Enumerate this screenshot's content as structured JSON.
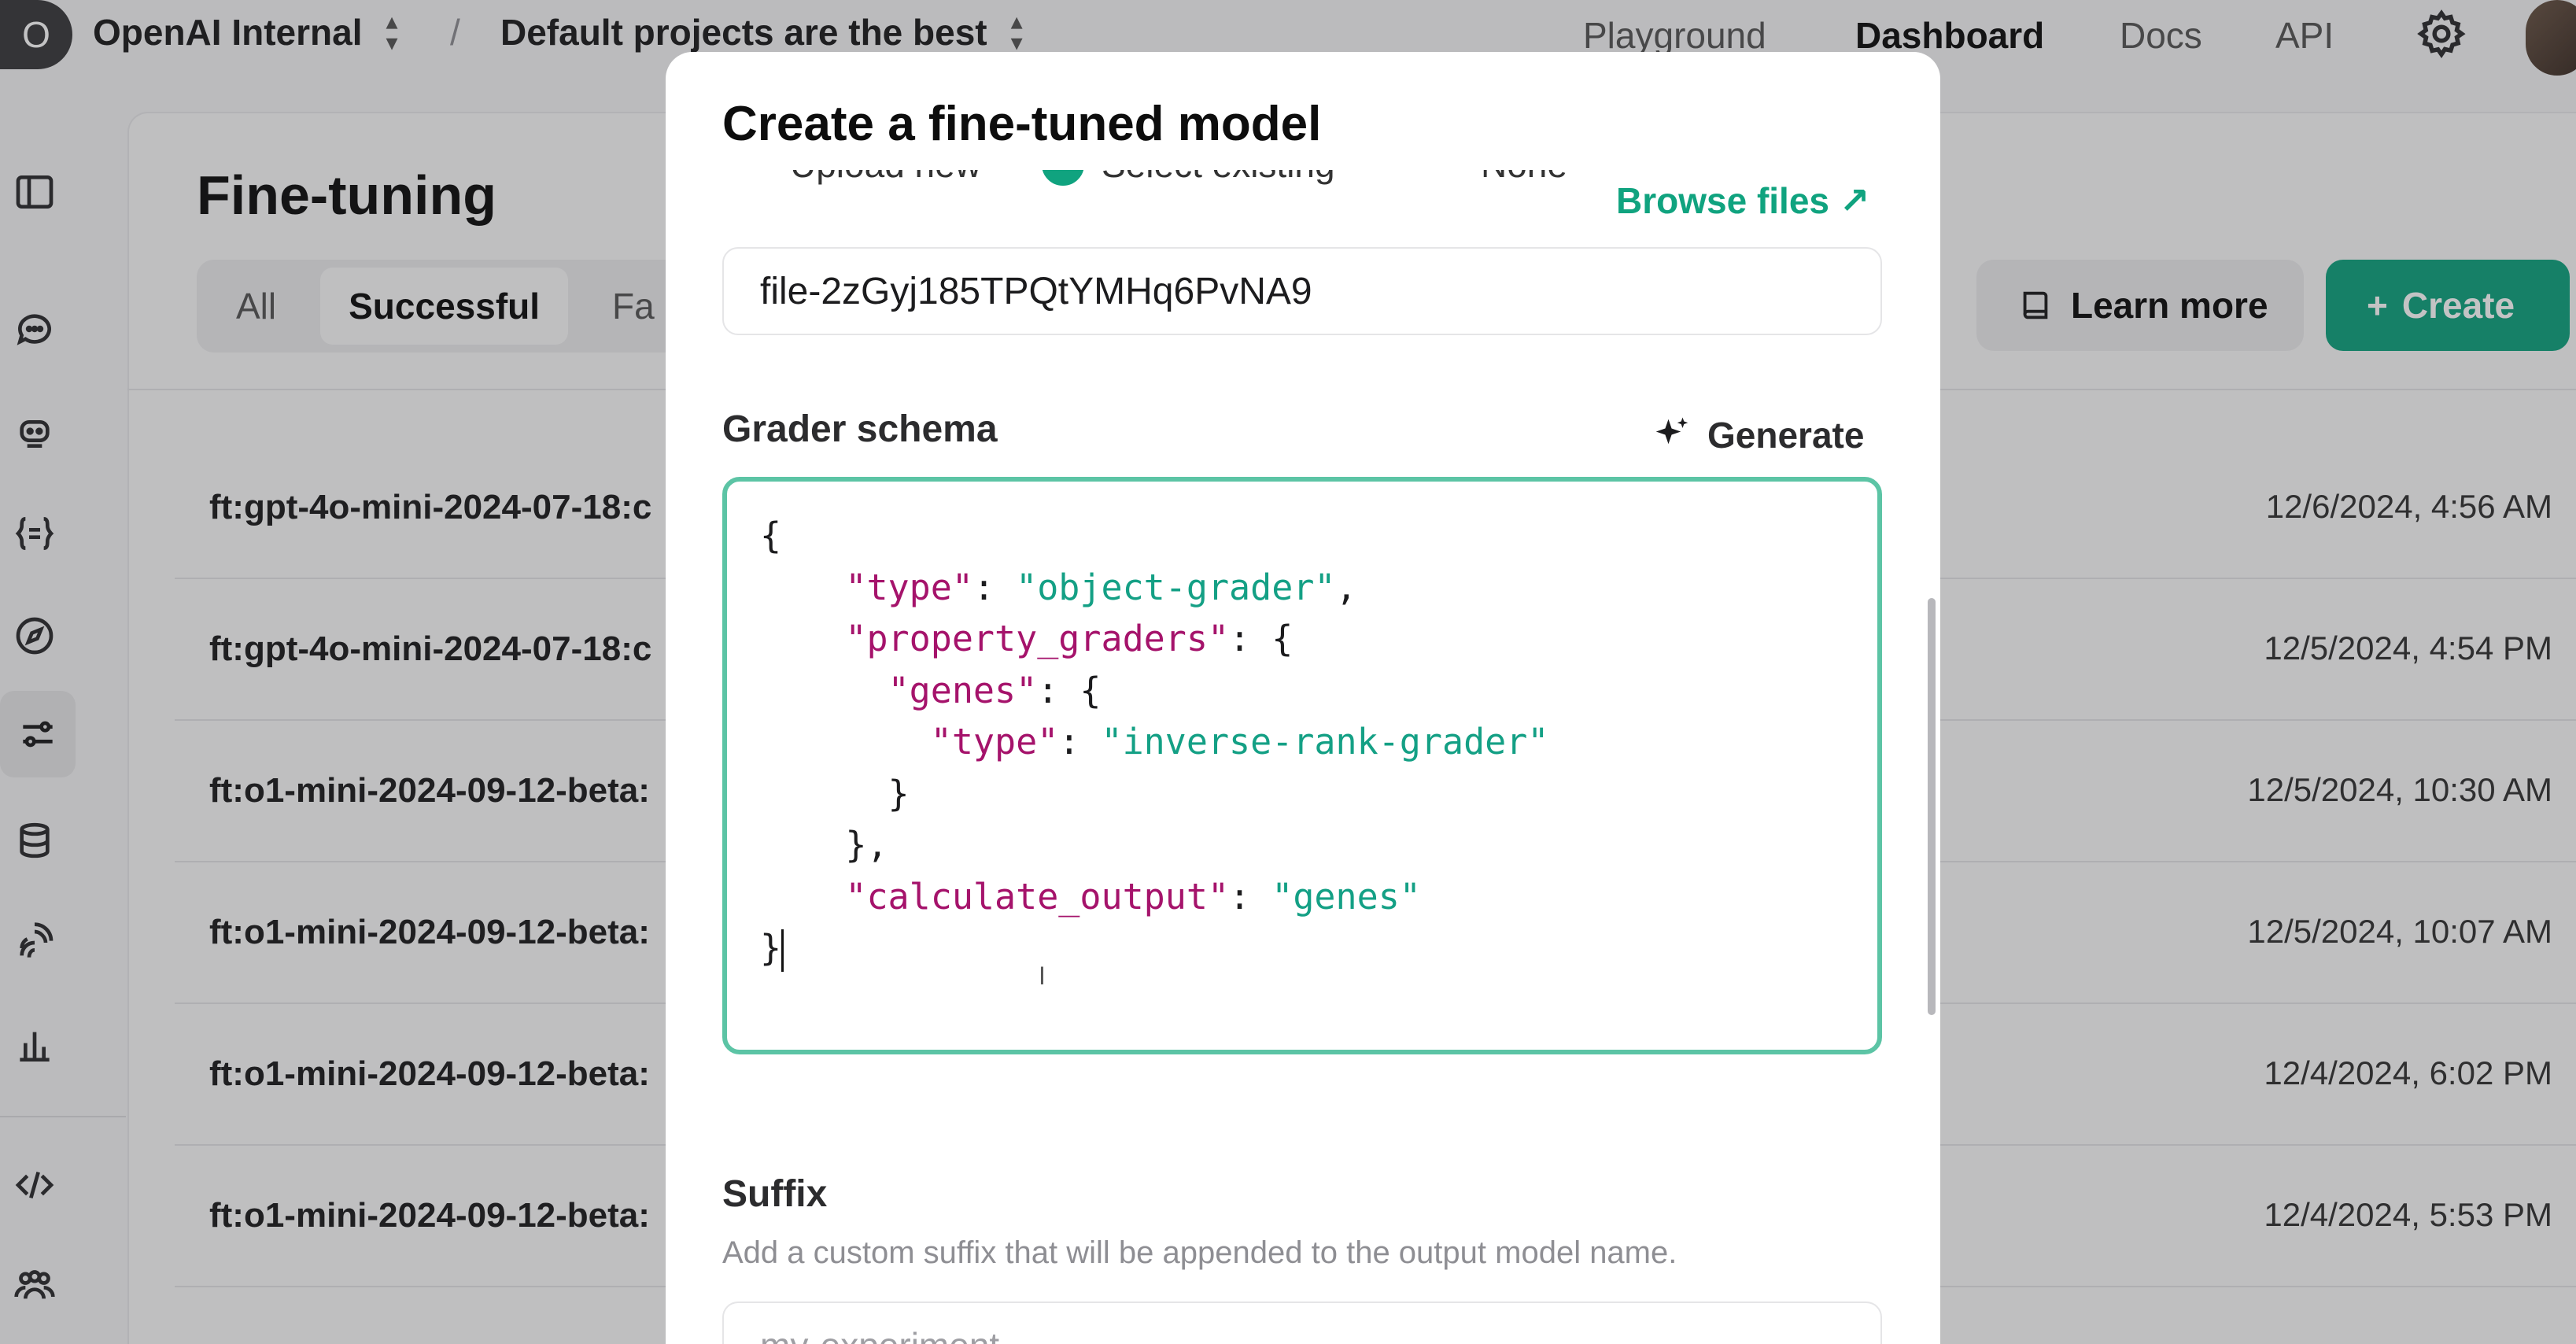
{
  "topbar": {
    "org_initial": "O",
    "org_name": "OpenAI Internal",
    "separator": "/",
    "project_name": "Default projects are the best",
    "nav": [
      "Playground",
      "Dashboard",
      "Docs",
      "API"
    ],
    "active_nav": "Dashboard"
  },
  "sidebar": {
    "icons": [
      "panel-toggle-icon",
      "chat-icon",
      "assistant-icon",
      "prompts-icon",
      "compass-icon",
      "sliders-icon",
      "database-icon",
      "audio-icon",
      "chart-icon",
      "code-icon",
      "team-icon"
    ],
    "active": "sliders-icon"
  },
  "page": {
    "title": "Fine-tuning",
    "filters": [
      "All",
      "Successful",
      "Fa"
    ],
    "active_filter": "Successful",
    "learn_more": "Learn more",
    "create": "Create"
  },
  "jobs": [
    {
      "name": "ft:gpt-4o-mini-2024-07-18:c",
      "date": "12/6/2024, 4:56 AM"
    },
    {
      "name": "ft:gpt-4o-mini-2024-07-18:c",
      "date": "12/5/2024, 4:54 PM"
    },
    {
      "name": "ft:o1-mini-2024-09-12-beta:",
      "date": "12/5/2024, 10:30 AM"
    },
    {
      "name": "ft:o1-mini-2024-09-12-beta:",
      "date": "12/5/2024, 10:07 AM"
    },
    {
      "name": "ft:o1-mini-2024-09-12-beta:",
      "date": "12/4/2024, 6:02 PM"
    },
    {
      "name": "ft:o1-mini-2024-09-12-beta:",
      "date": "12/4/2024, 5:53 PM"
    }
  ],
  "modal": {
    "title": "Create a fine-tuned model",
    "radio_upload": "Upload new",
    "radio_select": "Select existing",
    "radio_none": "None",
    "browse_files": "Browse files",
    "file_id": "file-2zGyj185TPQtYMHq6PvNA9",
    "grader_label": "Grader schema",
    "generate": "Generate",
    "schema": {
      "type_key": "\"type\"",
      "type_val": "\"object-grader\"",
      "pg_key": "\"property_graders\"",
      "genes_key": "\"genes\"",
      "inner_type_key": "\"type\"",
      "inner_type_val": "\"inverse-rank-grader\"",
      "calc_key": "\"calculate_output\"",
      "calc_val": "\"genes\""
    },
    "suffix_label": "Suffix",
    "suffix_help": "Add a custom suffix that will be appended to the output model name.",
    "suffix_placeholder": "my-experiment"
  },
  "colors": {
    "accent": "#10a37f",
    "json_key": "#a5136b",
    "json_string": "#14a085",
    "focus_border": "#5cc4a5"
  }
}
